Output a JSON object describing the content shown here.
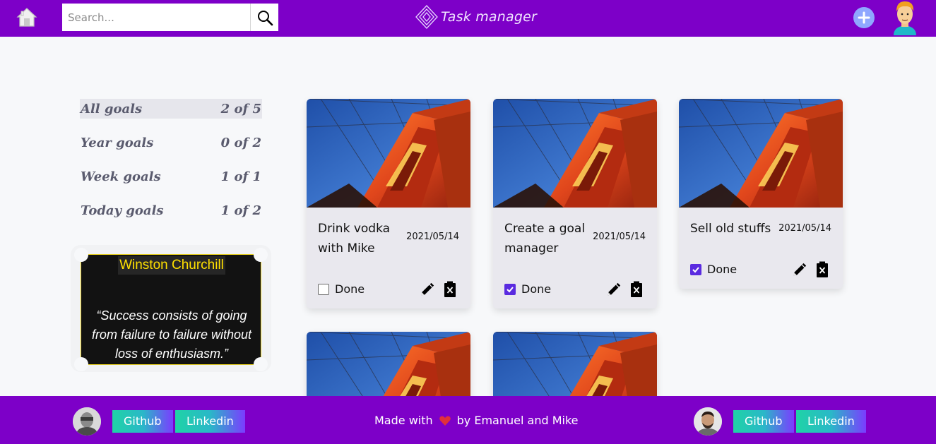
{
  "header": {
    "search_placeholder": "Search...",
    "brand": "Task manager",
    "accent_color": "#7d00c8"
  },
  "sidebar": {
    "goals": [
      {
        "label": "All goals",
        "count": "2 of 5",
        "active": true
      },
      {
        "label": "Year goals",
        "count": "0 of 2",
        "active": false
      },
      {
        "label": "Week goals",
        "count": "1 of 1",
        "active": false
      },
      {
        "label": "Today goals",
        "count": "1 of 2",
        "active": false
      }
    ]
  },
  "quote": {
    "author": "Winston Churchill",
    "text": "“Success consists of going from failure to failure without loss of enthusiasm.”"
  },
  "cards": [
    {
      "title": "Drink vodka with Mike",
      "date": "2021/05/14",
      "done_label": "Done",
      "done": false
    },
    {
      "title": "Create a goal manager",
      "date": "2021/05/14",
      "done_label": "Done",
      "done": true
    },
    {
      "title": "Sell old stuffs",
      "date": "2021/05/14",
      "done_label": "Done",
      "done": true
    }
  ],
  "footer": {
    "left_links": [
      "Github",
      "Linkedin"
    ],
    "right_links": [
      "Github",
      "Linkedin"
    ],
    "made_with": "Made with",
    "by": "by Emanuel and Mike"
  }
}
